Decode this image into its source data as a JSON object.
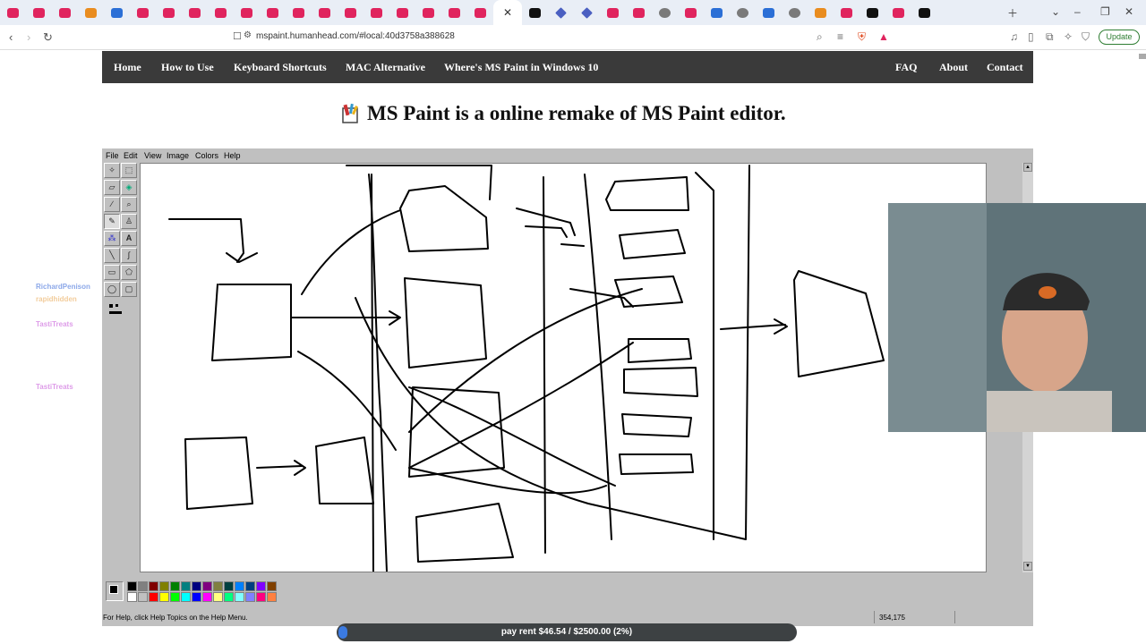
{
  "browser": {
    "url": "mspaint.humanhead.com/#local:40d3758a388628",
    "update_label": "Update"
  },
  "site_nav": {
    "left": [
      "Home",
      "How to Use",
      "Keyboard Shortcuts",
      "MAC Alternative",
      "Where's MS Paint in Windows 10"
    ],
    "right": [
      "FAQ",
      "About",
      "Contact"
    ]
  },
  "page_title": "MS Paint is a online remake of MS Paint editor.",
  "paint": {
    "menus": [
      "File",
      "Edit",
      "View",
      "Image",
      "Colors",
      "Help"
    ],
    "status_help": "For Help, click Help Topics on the Help Menu.",
    "coords": "354,175",
    "palette_colors": [
      "#000000",
      "#808080",
      "#800000",
      "#808000",
      "#008000",
      "#008080",
      "#000080",
      "#800080",
      "#808040",
      "#004040",
      "#0080ff",
      "#004080",
      "#8000ff",
      "#804000",
      "#ffffff",
      "#c0c0c0",
      "#ff0000",
      "#ffff00",
      "#00ff00",
      "#00ffff",
      "#0000ff",
      "#ff00ff",
      "#ffff80",
      "#00ff80",
      "#80ffff",
      "#8080ff",
      "#ff0080",
      "#ff8040"
    ]
  },
  "chat": [
    {
      "user": "RichardPenison",
      "color": "#2b5fd6"
    },
    {
      "user": "rapidhidden",
      "color": "#e8a34a"
    },
    {
      "user": "TastiTreats",
      "color": "#c24bd6"
    },
    {
      "user": "TastiTreats",
      "color": "#c24bd6"
    }
  ],
  "goal": {
    "text": "pay rent $46.54 / $2500.00 (2%)",
    "progress": 0.02
  }
}
